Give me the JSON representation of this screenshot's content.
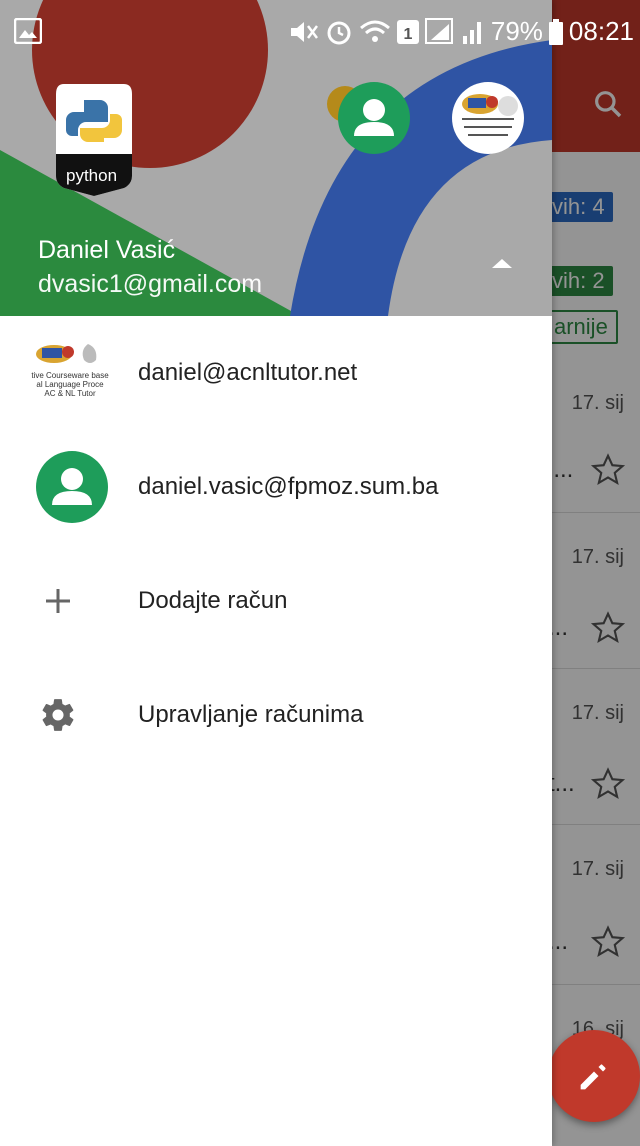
{
  "status_bar": {
    "battery": "79%",
    "time": "08:21"
  },
  "drawer": {
    "current_account": {
      "name": "Daniel Vasić",
      "email": "dvasic1@gmail.com",
      "avatar_label": "python"
    },
    "accounts": [
      {
        "email": "daniel@acnltutor.net",
        "avatar": "acnl-logo"
      },
      {
        "email": "daniel.vasic@fpmoz.sum.ba",
        "avatar": "default-person"
      }
    ],
    "actions": [
      {
        "label": "Dodajte račun",
        "icon": "add-icon"
      },
      {
        "label": "Upravljanje računima",
        "icon": "gear-icon"
      }
    ],
    "logo_caption_lines": [
      "tive Courseware base",
      "al Language Proce",
      "AC & NL Tutor"
    ]
  },
  "background_list": {
    "chip_1": "vih: 4",
    "chip_2": "vih: 2",
    "chip_3": "arnije",
    "rows": [
      {
        "date": "17. sij",
        "snippet": "j..."
      },
      {
        "date": "17. sij",
        "snippet": "..."
      },
      {
        "date": "17. sij",
        "snippet": "t..."
      },
      {
        "date": "17. sij",
        "snippet": "..."
      },
      {
        "date": "16. sij",
        "snippet": ""
      }
    ]
  },
  "colors": {
    "toolbar": "#c5392b",
    "header_red": "#8b2a21",
    "header_blue": "#2f54a4",
    "header_green": "#2b8a3e",
    "avatar_green": "#1e9d5a"
  }
}
